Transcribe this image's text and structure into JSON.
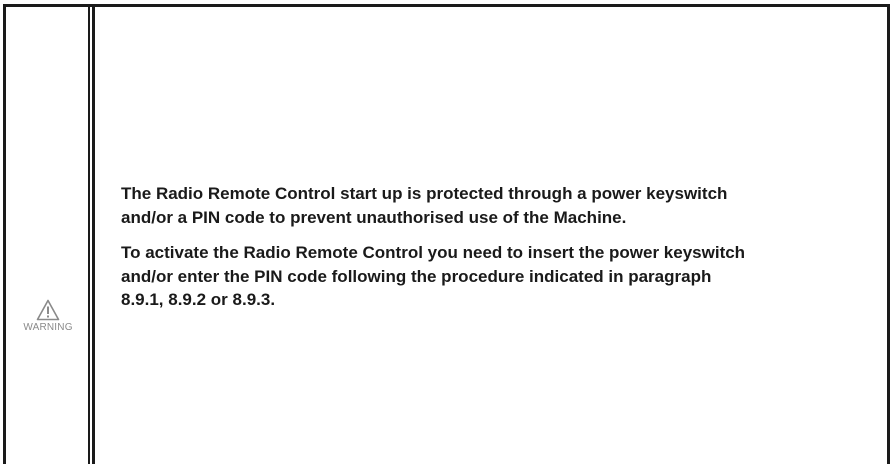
{
  "warning": {
    "icon": "warning-triangle-icon",
    "label": "WARNING"
  },
  "paragraphs": [
    {
      "lines": [
        "The Radio Remote Control start up is protected through a power keyswitch",
        "and/or a PIN code to prevent unauthorised use of the Machine."
      ]
    },
    {
      "lines": [
        "To activate the Radio Remote Control you need to insert the power keyswitch",
        "and/or enter the PIN code following the procedure indicated in paragraph",
        "8.9.1, 8.9.2 or 8.9.3."
      ]
    }
  ]
}
